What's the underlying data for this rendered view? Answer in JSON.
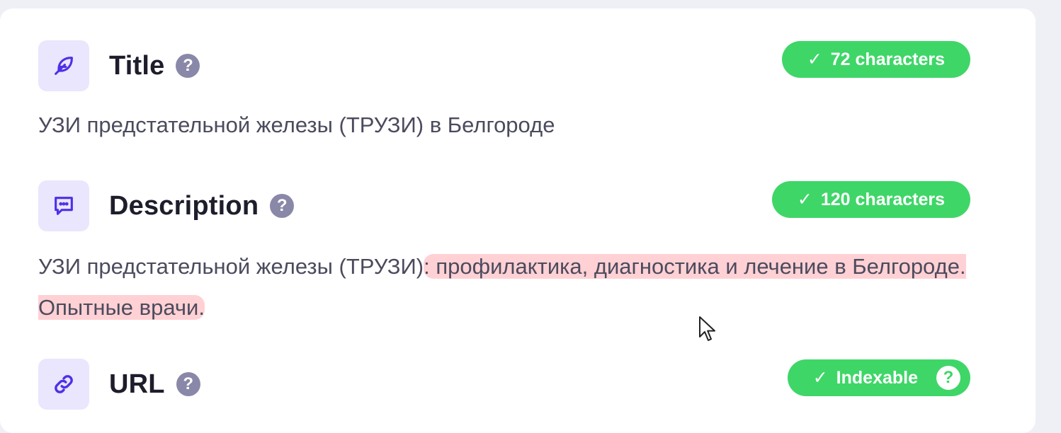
{
  "title_section": {
    "label": "Title",
    "help": "?",
    "badge": "72 characters",
    "check": "✓",
    "value": "УЗИ предстательной железы (ТРУЗИ) в Белгороде",
    "icon": "feather-icon"
  },
  "description_section": {
    "label": "Description",
    "help": "?",
    "badge": "120 characters",
    "check": "✓",
    "value_normal": "УЗИ предстательной железы (ТРУЗИ)",
    "value_highlighted": ": профилактика, диагностика и лечение в Белгороде. Опытные врачи.",
    "icon": "message-icon"
  },
  "url_section": {
    "label": "URL",
    "help": "?",
    "badge": "Indexable",
    "check": "✓",
    "badge_help": "?",
    "icon": "link-icon"
  },
  "colors": {
    "accent": "#5b3df5",
    "badge_green": "#3fd668",
    "highlight": "#ffd1d4",
    "icon_bg": "#e9e6fd"
  }
}
